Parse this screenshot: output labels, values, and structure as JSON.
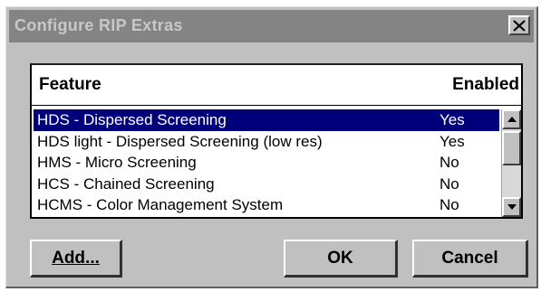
{
  "window": {
    "title": "Configure RIP Extras",
    "close_label": "X"
  },
  "list": {
    "header_feature": "Feature",
    "header_enabled": "Enabled",
    "rows": [
      {
        "feature": "HDS  - Dispersed Screening",
        "enabled": "Yes",
        "selected": true
      },
      {
        "feature": "HDS light - Dispersed Screening (low res)",
        "enabled": "Yes",
        "selected": false
      },
      {
        "feature": "HMS  - Micro Screening",
        "enabled": "No",
        "selected": false
      },
      {
        "feature": "HCS  - Chained Screening",
        "enabled": "No",
        "selected": false
      },
      {
        "feature": "HCMS - Color Management System",
        "enabled": "No",
        "selected": false
      }
    ]
  },
  "buttons": {
    "add": "Add...",
    "ok": "OK",
    "cancel": "Cancel"
  },
  "colors": {
    "dialog_bg": "#c0c0c0",
    "titlebar_inactive": "#848484",
    "selection": "#00007b"
  },
  "icons": {
    "close": "close-icon",
    "scroll_up": "scroll-up-arrow-icon",
    "scroll_down": "scroll-down-arrow-icon"
  }
}
